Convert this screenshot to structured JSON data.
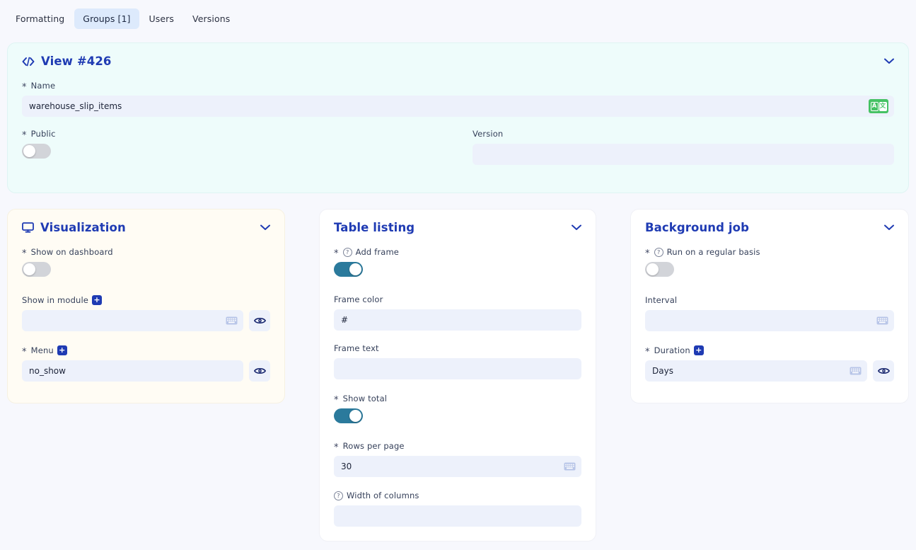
{
  "tabs": [
    {
      "label": "Formatting",
      "active": false
    },
    {
      "label": "Groups [1]",
      "active": true
    },
    {
      "label": "Users",
      "active": false
    },
    {
      "label": "Versions",
      "active": false
    }
  ],
  "view_card": {
    "title": "View #426",
    "icon": "code-brackets-icon",
    "name": {
      "label": "Name",
      "required": true,
      "value": "warehouse_slip_items"
    },
    "public": {
      "label": "Public",
      "required": true,
      "value": false
    },
    "version": {
      "label": "Version",
      "required": false,
      "value": ""
    },
    "translate_icon": {
      "left": "A",
      "right": "文"
    }
  },
  "visualization_card": {
    "title": "Visualization",
    "icon": "monitor-icon",
    "show_on_dashboard": {
      "label": "Show on dashboard",
      "required": true,
      "value": false
    },
    "show_in_module": {
      "label": "Show in module",
      "required": false,
      "value": "",
      "add_label": "+"
    },
    "menu": {
      "label": "Menu",
      "required": true,
      "value": "no_show",
      "add_label": "+"
    }
  },
  "table_listing_card": {
    "title": "Table listing",
    "add_frame": {
      "label": "Add frame",
      "required": true,
      "value": true,
      "help": "?"
    },
    "frame_color": {
      "label": "Frame color",
      "required": false,
      "value": "#"
    },
    "frame_text": {
      "label": "Frame text",
      "required": false,
      "value": ""
    },
    "show_total": {
      "label": "Show total",
      "required": true,
      "value": true
    },
    "rows_per_page": {
      "label": "Rows per page",
      "required": true,
      "value": "30"
    },
    "width_of_columns": {
      "label": "Width of columns",
      "required": false,
      "value": "",
      "help": "?"
    }
  },
  "background_job_card": {
    "title": "Background job",
    "run_regular": {
      "label": "Run on a regular basis",
      "required": true,
      "value": false,
      "help": "?"
    },
    "interval": {
      "label": "Interval",
      "required": false,
      "value": ""
    },
    "duration": {
      "label": "Duration",
      "required": true,
      "value": "Days",
      "add_label": "+"
    }
  },
  "colors": {
    "page_bg": "#f7f8fd",
    "accent": "#1f3bb3",
    "toggle_on": "#2b7a9c",
    "toggle_off": "#d2d4d9",
    "input_bg": "#edf1fb",
    "mint_card": "#eefcfb",
    "cream_card": "#fffcf4",
    "translate_green": "#46c264",
    "tab_active_bg": "#ddeafc"
  }
}
